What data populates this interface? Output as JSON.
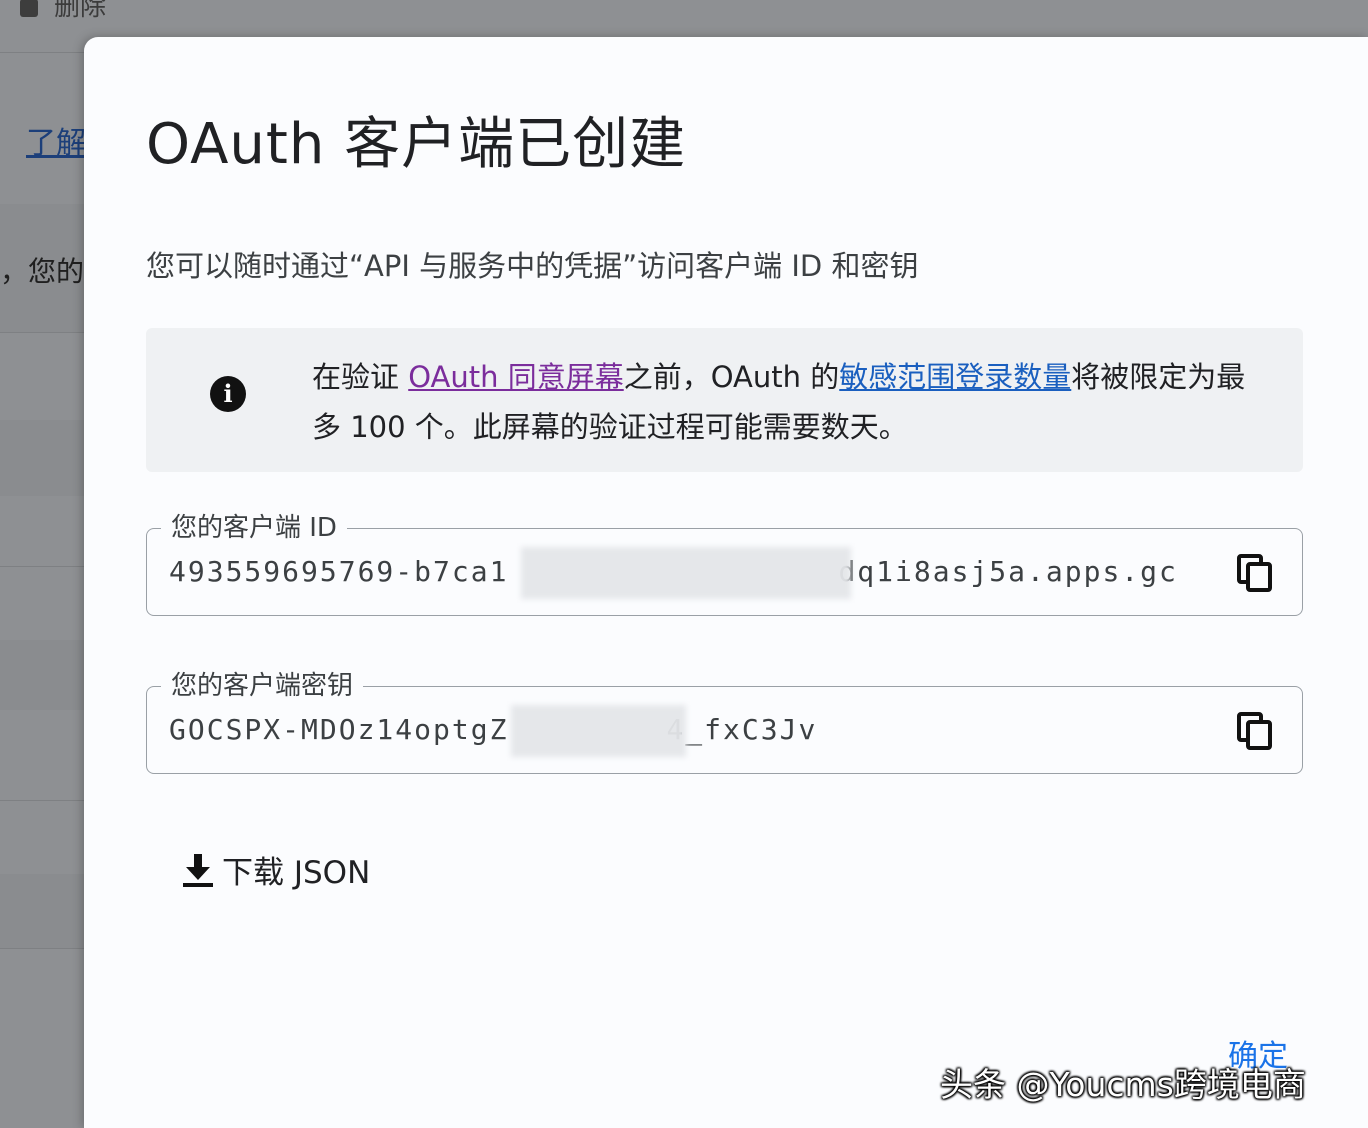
{
  "background": {
    "top_item": "删除",
    "link": "了解",
    "text": "，您的"
  },
  "dialog": {
    "title": "OAuth 客户端已创建",
    "description": "您可以随时通过“API 与服务中的凭据”访问客户端 ID 和密钥",
    "info": {
      "icon": "info-icon",
      "text_1": "在验证 ",
      "link_consent": "OAuth 同意屏幕",
      "text_2": "之前，OAuth 的",
      "link_scopes": "敏感范围登录数量",
      "text_3": "将被限定为最多 100 个。此屏幕的验证过程可能需要数天。"
    },
    "client_id": {
      "label": "您的客户端 ID",
      "value": "493559695769-b7ca1",
      "value_tail": "dq1i8asj5a.apps.gc",
      "copy_icon": "copy-icon"
    },
    "client_secret": {
      "label": "您的客户端密钥",
      "value": "GOCSPX-MDOz14optgZ",
      "value_tail": "4_fxC3Jv",
      "copy_icon": "copy-icon"
    },
    "download": {
      "icon": "download-icon",
      "label": "下载 JSON"
    },
    "ok_label": "确定"
  },
  "watermark": "头条 @Youcms跨境电商"
}
